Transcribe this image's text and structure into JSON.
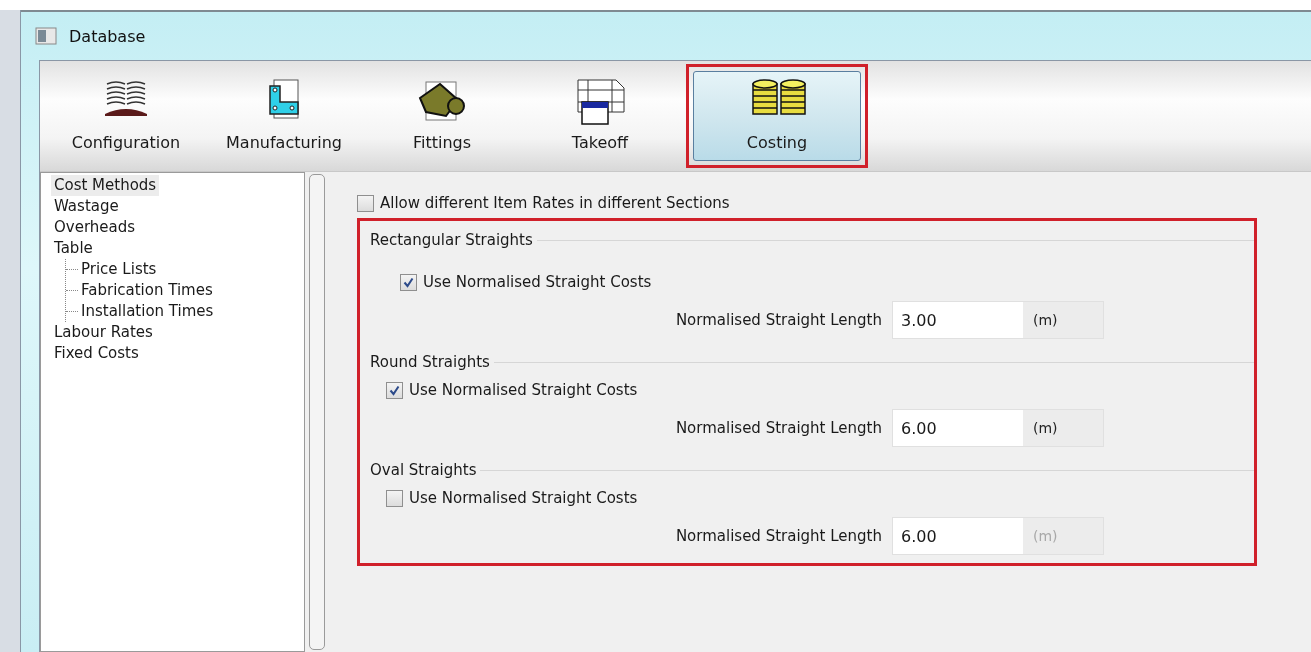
{
  "window": {
    "title": "Database"
  },
  "tabs": [
    {
      "label": "Configuration",
      "selected": false
    },
    {
      "label": "Manufacturing",
      "selected": false
    },
    {
      "label": "Fittings",
      "selected": false
    },
    {
      "label": "Takeoff",
      "selected": false
    },
    {
      "label": "Costing",
      "selected": true
    }
  ],
  "tree": [
    {
      "label": "Cost Methods",
      "selected": true
    },
    {
      "label": "Wastage",
      "selected": false
    },
    {
      "label": "Overheads",
      "selected": false
    },
    {
      "label": "Table",
      "selected": false,
      "children": [
        {
          "label": "Price Lists",
          "selected": false
        },
        {
          "label": "Fabrication Times",
          "selected": false
        },
        {
          "label": "Installation Times",
          "selected": false
        }
      ]
    },
    {
      "label": "Labour Rates",
      "selected": false
    },
    {
      "label": "Fixed Costs",
      "selected": false
    }
  ],
  "allow_rates": {
    "label": "Allow different Item Rates in different Sections",
    "checked": false
  },
  "sections": [
    {
      "title": "Rectangular Straights",
      "use_label": "Use Normalised Straight Costs",
      "checked": true,
      "length_label": "Normalised Straight Length",
      "value": "3.00",
      "unit": "(m)",
      "disabled": false
    },
    {
      "title": "Round Straights",
      "use_label": "Use Normalised Straight Costs",
      "checked": true,
      "length_label": "Normalised Straight Length",
      "value": "6.00",
      "unit": "(m)",
      "disabled": false
    },
    {
      "title": "Oval Straights",
      "use_label": "Use Normalised Straight Costs",
      "checked": false,
      "length_label": "Normalised Straight Length",
      "value": "6.00",
      "unit": "(m)",
      "disabled": true
    }
  ]
}
